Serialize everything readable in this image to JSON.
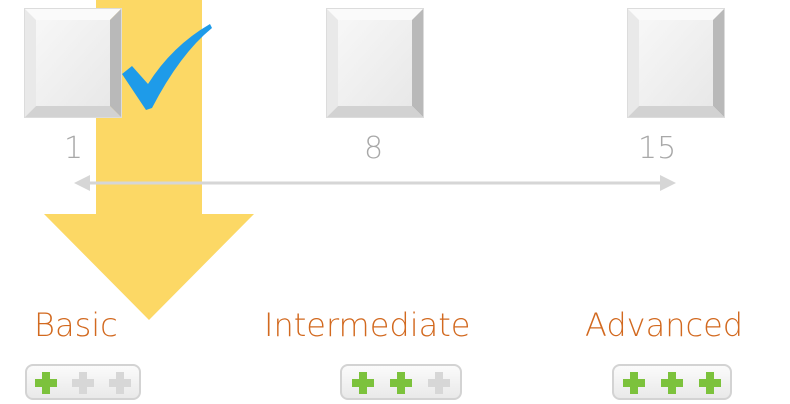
{
  "scale": {
    "marks": [
      "1",
      "8",
      "15"
    ]
  },
  "levels": [
    {
      "label": "Basic",
      "rating": 1,
      "max": 3
    },
    {
      "label": "Intermediate",
      "rating": 2,
      "max": 3
    },
    {
      "label": "Advanced",
      "rating": 3,
      "max": 3
    }
  ],
  "selected_level": "Basic",
  "colors": {
    "label_orange": "#d2691f",
    "plus_green": "#7cc23c",
    "plus_gray": "#d7d7d7",
    "arrow_yellow": "#fcd865",
    "check_blue": "#1e9be9",
    "number_gray": "#a8a8a8",
    "range_line": "#d6d6d6"
  },
  "icons": {
    "arrow": "down-arrow-icon",
    "check": "checkmark-icon",
    "range": "double-headed-arrow-icon",
    "plus": "plus-icon"
  }
}
